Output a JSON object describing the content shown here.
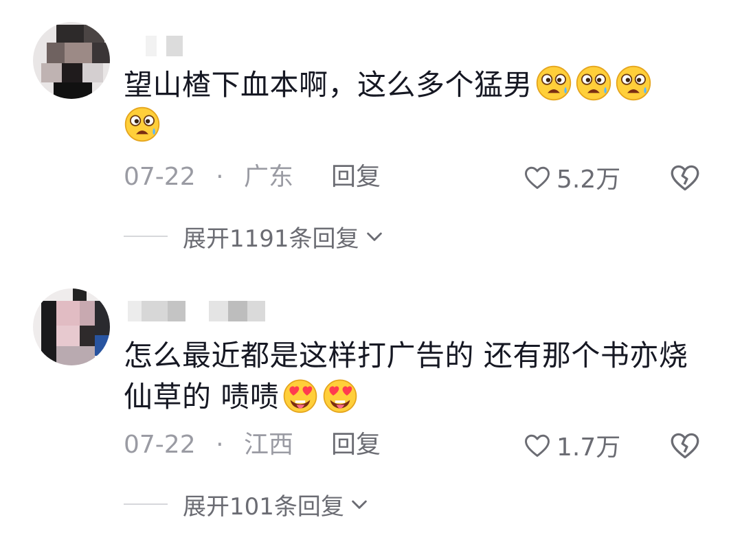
{
  "comments": [
    {
      "text": "望山楂下血本啊，这么多个猛男",
      "emoji": [
        "worried-face-emoji",
        "worried-face-emoji",
        "worried-face-emoji",
        "worried-face-emoji"
      ],
      "date": "07-22",
      "dot": "·",
      "region": "广东",
      "reply_label": "回复",
      "likes": "5.2万",
      "expand_label": "展开1191条回复"
    },
    {
      "text": "怎么最近都是这样打广告的 还有那个书亦烧仙草的 啧啧",
      "emoji": [
        "heart-eyes-tongue-emoji",
        "heart-eyes-tongue-emoji"
      ],
      "date": "07-22",
      "dot": "·",
      "region": "江西",
      "reply_label": "回复",
      "likes": "1.7万",
      "expand_label": "展开101条回复"
    }
  ],
  "icons": {
    "like": "heart-outline-icon",
    "dislike": "broken-heart-icon",
    "expand": "chevron-down-icon"
  },
  "colors": {
    "text": "#161823",
    "meta": "#9a9ba3",
    "action": "#6b6c73"
  }
}
